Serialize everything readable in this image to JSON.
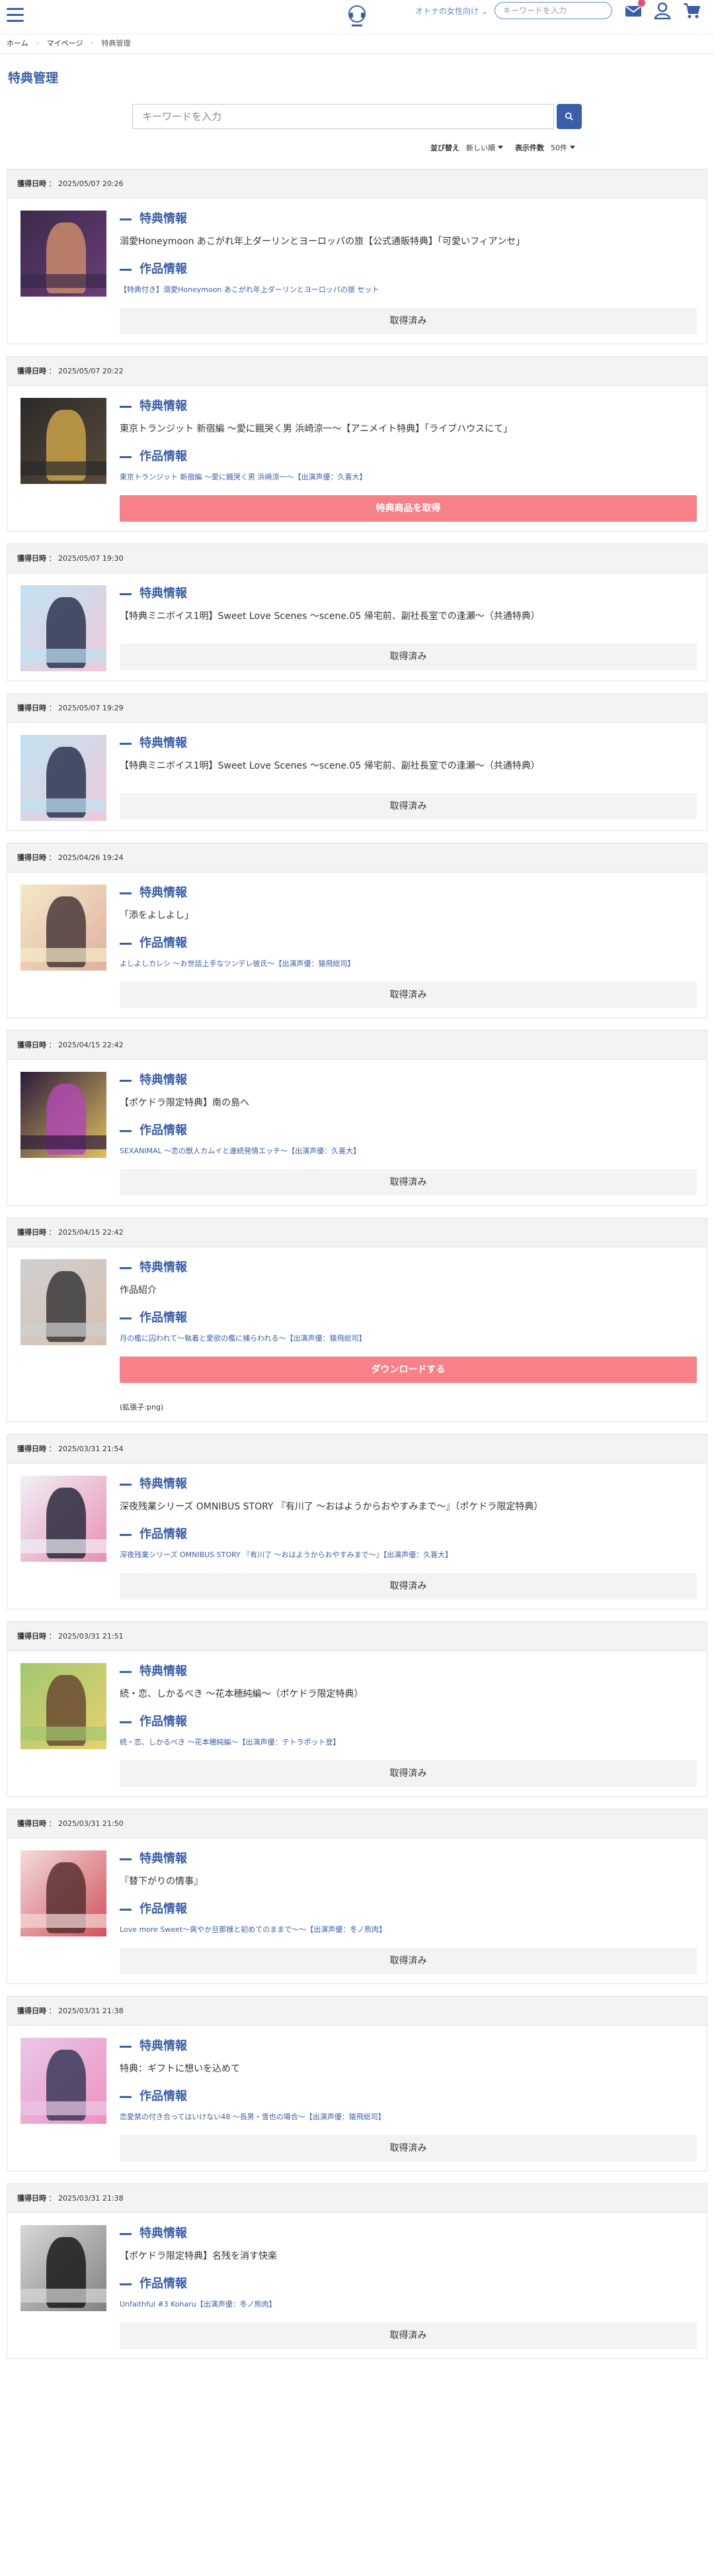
{
  "header": {
    "gender_link": "オトナの女性向け",
    "search_placeholder": "キーワードを入力"
  },
  "breadcrumb": {
    "home": "ホーム",
    "mypage": "マイページ",
    "current": "特典管理"
  },
  "page_title": "特典管理",
  "search": {
    "placeholder": "キーワードを入力"
  },
  "sort": {
    "label": "並び替え",
    "value": "新しい順",
    "count_label": "表示件数",
    "count_value": "50件"
  },
  "labels": {
    "acquired_label": "獲得日時",
    "benefit_heading": "特典情報",
    "work_heading": "作品情報"
  },
  "cards": [
    {
      "date": "2025/05/07 20:26",
      "benefit": "溺愛Honeymoon あこがれ年上ダーリンとヨーロッパの旅【公式通販特典】「可愛いフィアンセ」",
      "work": "【特典付き】溺愛Honeymoon あこがれ年上ダーリンとヨーロッパの旅 セット",
      "button": "取得済み",
      "button_style": "done",
      "note": "",
      "thumb_colors": [
        "#3b2a4a",
        "#c98a6a",
        "#6a3d7a"
      ]
    },
    {
      "date": "2025/05/07 20:22",
      "benefit": "東京トランジット 新宿編 ～愛に餓哭く男 浜崎涼一～【アニメイト特典】「ライブハウスにて」",
      "work": "東京トランジット 新宿編 ～愛に餓哭く男 浜崎涼一～【出演声優：久喜大】",
      "button": "特典商品を取得",
      "button_style": "pink",
      "note": "",
      "thumb_colors": [
        "#2a2a2a",
        "#c9a24a",
        "#5a4a3a"
      ]
    },
    {
      "date": "2025/05/07 19:30",
      "benefit": "【特典ミニボイス1明】Sweet Love Scenes ～scene.05 帰宅前、副社長室での逢瀬～（共通特典）",
      "work": "",
      "button": "取得済み",
      "button_style": "done",
      "note": "",
      "thumb_colors": [
        "#bfe3f2",
        "#2a3550",
        "#f0c8d8"
      ]
    },
    {
      "date": "2025/05/07 19:29",
      "benefit": "【特典ミニボイス1明】Sweet Love Scenes ～scene.05 帰宅前、副社長室での逢瀬～（共通特典）",
      "work": "",
      "button": "取得済み",
      "button_style": "done",
      "note": "",
      "thumb_colors": [
        "#bfe3f2",
        "#2a3550",
        "#f0c8d8"
      ]
    },
    {
      "date": "2025/04/26 19:24",
      "benefit": "「添をよしよし」",
      "work": "よしよしカレシ ～お世話上手なツンデレ彼氏～【出演声優：猿飛総司】",
      "button": "取得済み",
      "button_style": "done",
      "note": "",
      "thumb_colors": [
        "#f4e9c8",
        "#4a3a3a",
        "#e0b0a0"
      ]
    },
    {
      "date": "2025/04/15 22:42",
      "benefit": "【ポケドラ限定特典】南の島へ",
      "work": "SEXANIMAL ～恋の獣人カムイと連続発情エッチ～【出演声優：久喜大】",
      "button": "取得済み",
      "button_style": "done",
      "note": "",
      "thumb_colors": [
        "#2a1a3a",
        "#b04ab0",
        "#e0c060"
      ]
    },
    {
      "date": "2025/04/15 22:42",
      "benefit": "作品紹介",
      "work": "月の檻に囚われて～執着と愛欲の檻に捕らわれる～【出演声優：猿飛総司】",
      "button": "ダウンロードする",
      "button_style": "pink",
      "note": "(拡張子:png)",
      "thumb_colors": [
        "#cfcfcf",
        "#3a3a3a",
        "#d8c0b0"
      ]
    },
    {
      "date": "2025/03/31 21:54",
      "benefit": "深夜残業シリーズ OMNIBUS STORY 『有川了 ～おはようからおやすみまで～』（ポケドラ限定特典）",
      "work": "深夜残業シリーズ OMNIBUS STORY 『有川了 ～おはようからおやすみまで～』【出演声優：久喜大】",
      "button": "取得済み",
      "button_style": "done",
      "note": "",
      "thumb_colors": [
        "#f0f0f8",
        "#2a2a40",
        "#e890b0"
      ]
    },
    {
      "date": "2025/03/31 21:51",
      "benefit": "続・恋、しかるべき ～花本穂純編～（ポケドラ限定特典）",
      "work": "続・恋、しかるべき ～花本穂純編～【出演声優：テトラポット登】",
      "button": "取得済み",
      "button_style": "done",
      "note": "",
      "thumb_colors": [
        "#a0c870",
        "#6a4a30",
        "#e8d070"
      ]
    },
    {
      "date": "2025/03/31 21:50",
      "benefit": "『替下がりの情事』",
      "work": "Love more Sweet～爽やか旦那様と初めてのままで～～【出演声優：冬ノ熊肉】",
      "button": "取得済み",
      "button_style": "done",
      "note": "",
      "thumb_colors": [
        "#f4dcd8",
        "#5a3030",
        "#d05060"
      ]
    },
    {
      "date": "2025/03/31 21:38",
      "benefit": "特典：ギフトに想いを込めて",
      "work": "恋愛禁の付き合ってはいけない48 ～長男・雪也の場合～【出演声優：猿飛総司】",
      "button": "取得済み",
      "button_style": "done",
      "note": "",
      "thumb_colors": [
        "#e8c8e8",
        "#3a3a5a",
        "#f090c0"
      ]
    },
    {
      "date": "2025/03/31 21:38",
      "benefit": "【ポケドラ限定特典】名残を消す快楽",
      "work": "Unfaithful #3 Koharu【出演声優：冬ノ熊肉】",
      "button": "取得済み",
      "button_style": "done",
      "note": "",
      "thumb_colors": [
        "#d8d8d8",
        "#1a1a1a",
        "#808080"
      ]
    }
  ]
}
